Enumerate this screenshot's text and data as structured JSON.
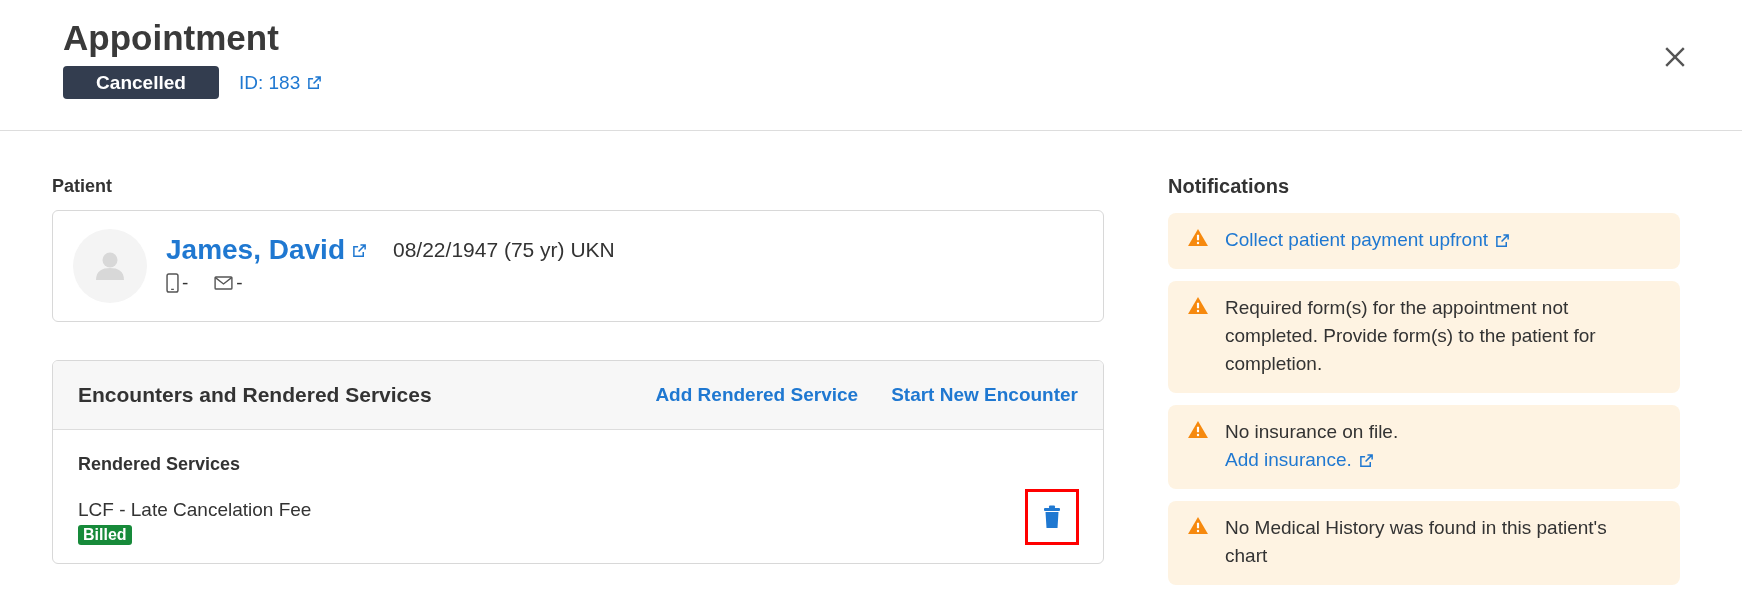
{
  "header": {
    "title": "Appointment",
    "status": "Cancelled",
    "id_link": "ID: 183"
  },
  "patient": {
    "label": "Patient",
    "name": "James, David",
    "details": "08/22/1947 (75 yr) UKN",
    "phone": "-",
    "email": "-"
  },
  "encounters": {
    "title": "Encounters and Rendered Services",
    "actions": [
      "Add Rendered Service",
      "Start New Encounter"
    ],
    "section_title": "Rendered Services",
    "services": [
      {
        "name": "LCF - Late Cancelation Fee",
        "status": "Billed",
        "delete_highlighted": true
      }
    ]
  },
  "notifications": {
    "title": "Notifications",
    "items": [
      {
        "lines": [
          {
            "text": "Collect patient payment upfront",
            "link": true
          }
        ]
      },
      {
        "lines": [
          {
            "text": "Required form(s) for the appointment not completed. Provide form(s) to the patient for completion.",
            "link": false
          }
        ]
      },
      {
        "lines": [
          {
            "text": "No insurance on file.",
            "link": false
          },
          {
            "text": "Add insurance.",
            "link": true
          }
        ]
      },
      {
        "lines": [
          {
            "text": "No Medical History was found in this patient's chart",
            "link": false
          }
        ]
      }
    ]
  }
}
